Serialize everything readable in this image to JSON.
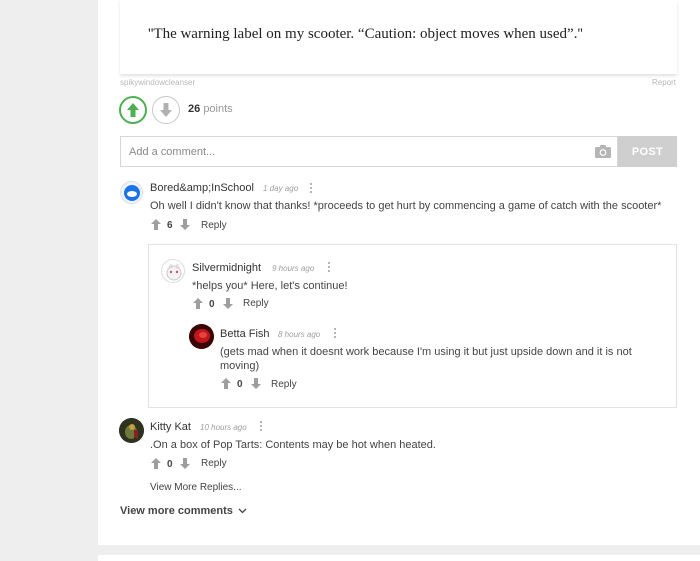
{
  "post": {
    "quote": "''The warning label on my scooter. “Caution: object moves when used”.''",
    "credit": "spikywindowcleanser",
    "report_label": "Report",
    "points_count": "26",
    "points_label": "points"
  },
  "comment_form": {
    "placeholder": "Add a comment...",
    "post_label": "POST"
  },
  "comments": [
    {
      "author": "Bored&amp;InSchool",
      "time": "1 day ago",
      "text": "Oh well I didn't know that thanks! *proceeds to get hurt by commencing a game of catch with the scooter*",
      "votes": "6",
      "reply_label": "Reply",
      "replies": [
        {
          "author": "Silvermidnight",
          "time": "9 hours ago",
          "text": "*helps you* Here, let's continue!",
          "votes": "0",
          "reply_label": "Reply"
        },
        {
          "author": "Betta Fish",
          "time": "8 hours ago",
          "text": "(gets mad when it doesnt work because I'm using it but just upside down and it is not moving)",
          "votes": "0",
          "reply_label": "Reply"
        }
      ]
    },
    {
      "author": "Kitty Kat",
      "time": "10 hours ago",
      "text": ".On a box of Pop Tarts: Contents may be hot when heated.",
      "votes": "0",
      "reply_label": "Reply",
      "more_replies_label": "View More Replies..."
    }
  ],
  "footer": {
    "more_comments_label": "View more comments"
  },
  "colors": {
    "upvote_green": "#4caf50",
    "post_button": "#cfcfcf",
    "page_bg": "#eeeeee"
  },
  "icons": [
    "arrow-up-icon",
    "arrow-down-icon",
    "camera-icon",
    "kebab-menu-icon",
    "chevron-down-icon"
  ]
}
